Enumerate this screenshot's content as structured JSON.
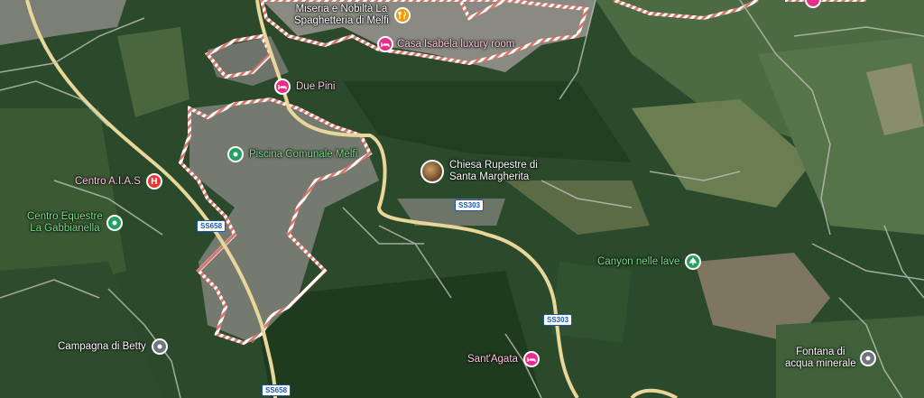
{
  "map": {
    "pois": [
      {
        "name": "Miseria e Nobiltà La Spaghetteria di Melfi",
        "line1": "Miseria e Nobiltà La",
        "line2": "Spaghetteria di Melfi",
        "type": "restaurant",
        "icon": "fork-knife-icon",
        "color": "#f29900"
      },
      {
        "name": "Casa Isabela luxury room",
        "type": "lodging",
        "icon": "bed-icon",
        "color": "#e52f8a"
      },
      {
        "name": "Due Pini",
        "type": "lodging",
        "icon": "bed-icon",
        "color": "#e52f8a"
      },
      {
        "name": "Piscina Comunale Melfi",
        "type": "sports",
        "icon": "map-pin-icon",
        "color": "#22a160"
      },
      {
        "name": "Centro A.I.A.S",
        "type": "hospital",
        "icon": "hospital-icon",
        "glyph": "H",
        "color": "#e53935"
      },
      {
        "name": "Centro Equestre La Gabbianella",
        "line1": "Centro Equestre",
        "line2": "La Gabbianella",
        "type": "sports",
        "icon": "map-pin-icon",
        "color": "#22a160"
      },
      {
        "name": "Chiesa Rupestre di Santa Margherita",
        "line1": "Chiesa Rupestre di",
        "line2": "Santa Margherita",
        "type": "photo",
        "icon": "photo-thumbnail-icon"
      },
      {
        "name": "Canyon nelle lave",
        "type": "park",
        "icon": "tree-icon",
        "color": "#2b9d5c"
      },
      {
        "name": "Campagna di Betty",
        "type": "place",
        "icon": "map-pin-icon",
        "color": "#6f7680"
      },
      {
        "name": "Sant'Agata",
        "type": "lodging",
        "icon": "bed-icon",
        "color": "#e52f8a"
      },
      {
        "name": "Fontana di acqua minerale",
        "line1": "Fontana di",
        "line2": "acqua minerale",
        "type": "place",
        "icon": "map-pin-icon",
        "color": "#6f7680"
      }
    ],
    "roads": [
      {
        "ref": "SS658"
      },
      {
        "ref": "SS658"
      },
      {
        "ref": "SS303"
      },
      {
        "ref": "SS303"
      }
    ]
  }
}
